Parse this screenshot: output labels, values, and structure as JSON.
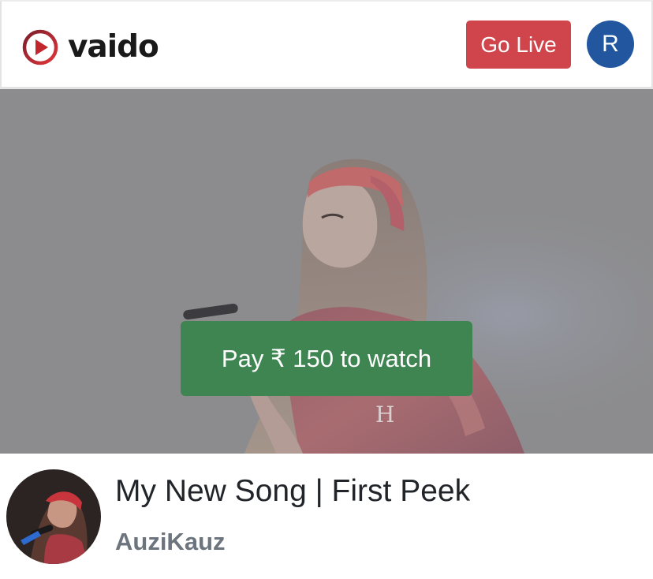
{
  "header": {
    "brand_name": "vaido",
    "go_live_label": "Go Live",
    "user_initial": "R"
  },
  "player": {
    "pay_label": "Pay ₹ 150 to watch"
  },
  "video_info": {
    "title": "My New Song | First Peek",
    "channel": "AuziKauz"
  },
  "colors": {
    "brand_red": "#c1272d",
    "go_live_bg": "#d0444b",
    "avatar_bg": "#22569f",
    "pay_button_bg": "#3f8552",
    "channel_text": "#6c757d"
  },
  "icons": {
    "brand": "play-circle-icon"
  }
}
